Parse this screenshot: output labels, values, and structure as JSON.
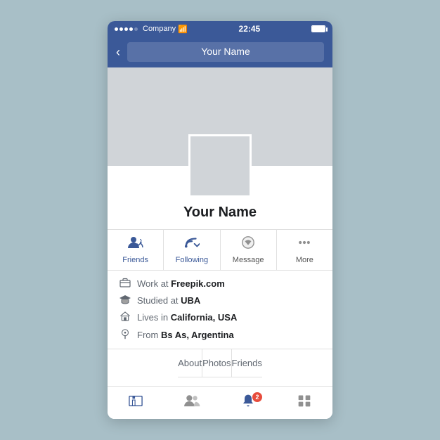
{
  "status_bar": {
    "carrier": "Company",
    "time": "22:45",
    "signal_dots": 4
  },
  "nav": {
    "back_label": "<",
    "title": "Your Name"
  },
  "profile": {
    "name": "Your Name"
  },
  "actions": [
    {
      "id": "friends",
      "label": "Friends",
      "icon": "friends",
      "blue": true
    },
    {
      "id": "following",
      "label": "Following",
      "icon": "following",
      "blue": true
    },
    {
      "id": "message",
      "label": "Message",
      "icon": "message",
      "blue": false
    },
    {
      "id": "more",
      "label": "More",
      "icon": "more",
      "blue": false
    }
  ],
  "info": [
    {
      "icon": "work",
      "text_pre": "Work at ",
      "text_bold": "Freepik.com"
    },
    {
      "icon": "study",
      "text_pre": "Studied at ",
      "text_bold": "UBA"
    },
    {
      "icon": "home",
      "text_pre": "Lives in ",
      "text_bold": "California, USA"
    },
    {
      "icon": "pin",
      "text_pre": "From ",
      "text_bold": "Bs As, Argentina"
    }
  ],
  "tabs": [
    "About",
    "Photos",
    "Friends"
  ],
  "bottom_nav": [
    {
      "id": "home",
      "icon": "home-nav"
    },
    {
      "id": "friends-nav",
      "icon": "friends-nav"
    },
    {
      "id": "notifications",
      "icon": "bell-nav",
      "badge": "2"
    },
    {
      "id": "menu",
      "icon": "menu-nav"
    }
  ]
}
